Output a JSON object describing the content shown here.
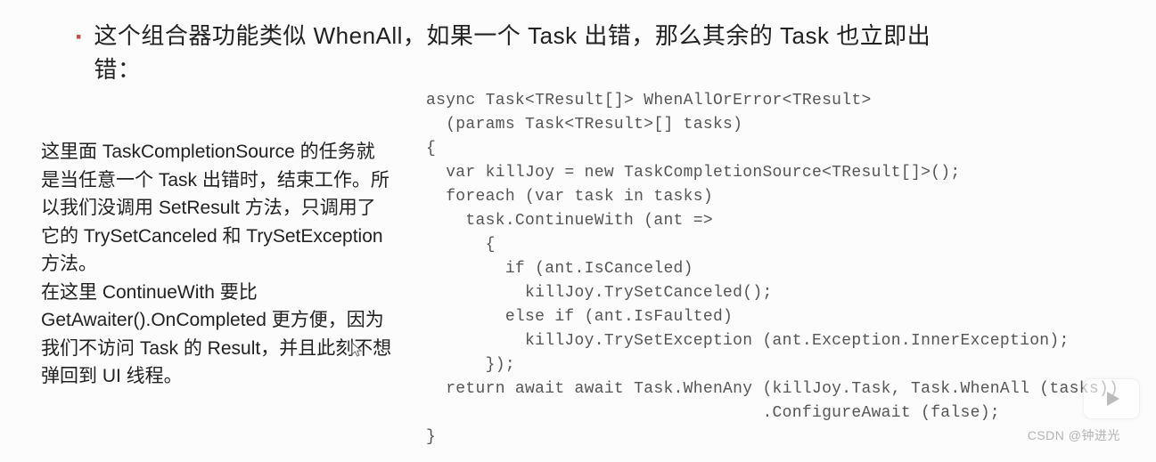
{
  "bullet": {
    "text": "这个组合器功能类似 WhenAll，如果一个 Task 出错，那么其余的 Task 也立即出错："
  },
  "explanation": {
    "text": "这里面 TaskCompletionSource 的任务就是当任意一个 Task 出错时，结束工作。所以我们没调用 SetResult 方法，只调用了它的 TrySetCanceled 和 TrySetException 方法。\n在这里 ContinueWith 要比 GetAwaiter().OnCompleted 更方便，因为我们不访问 Task 的 Result，并且此刻不想弹回到 UI 线程。"
  },
  "code": {
    "text": "async Task<TResult[]> WhenAllOrError<TResult>\n  (params Task<TResult>[] tasks)\n{\n  var killJoy = new TaskCompletionSource<TResult[]>();\n  foreach (var task in tasks)\n    task.ContinueWith (ant =>\n      {\n        if (ant.IsCanceled)\n          killJoy.TrySetCanceled();\n        else if (ant.IsFaulted)\n          killJoy.TrySetException (ant.Exception.InnerException);\n      });\n  return await await Task.WhenAny (killJoy.Task, Task.WhenAll (tasks))\n                                  .ConfigureAwait (false);\n}"
  },
  "watermark": {
    "text": "CSDN @钟进光"
  }
}
